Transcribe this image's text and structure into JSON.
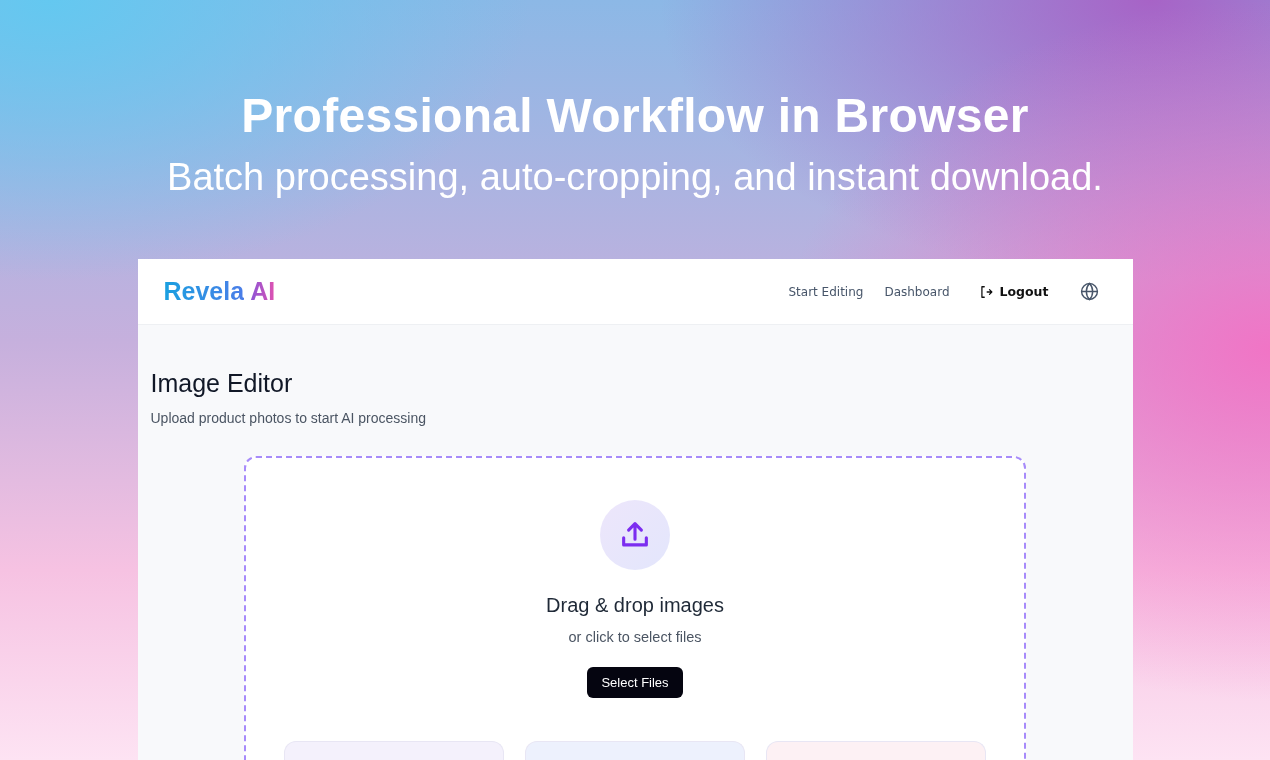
{
  "hero": {
    "title": "Professional Workflow in Browser",
    "subtitle": "Batch processing, auto-cropping, and instant download."
  },
  "app": {
    "logo": {
      "first": "Revela",
      "second": "AI"
    },
    "nav": [
      {
        "label": "Start Editing",
        "kind": "link"
      },
      {
        "label": "Dashboard",
        "kind": "link"
      },
      {
        "label": "Logout",
        "kind": "logout"
      },
      {
        "kind": "language"
      }
    ],
    "page_title": "Image Editor",
    "page_subtitle": "Upload product photos to start AI processing",
    "dropzone": {
      "title": "Drag & drop images",
      "hint": "or click to select files",
      "button": "Select Files"
    },
    "feature_cards": [
      {
        "color": "#f4f1fc"
      },
      {
        "color": "#edf1fd"
      },
      {
        "color": "#fdf1f4"
      }
    ]
  }
}
